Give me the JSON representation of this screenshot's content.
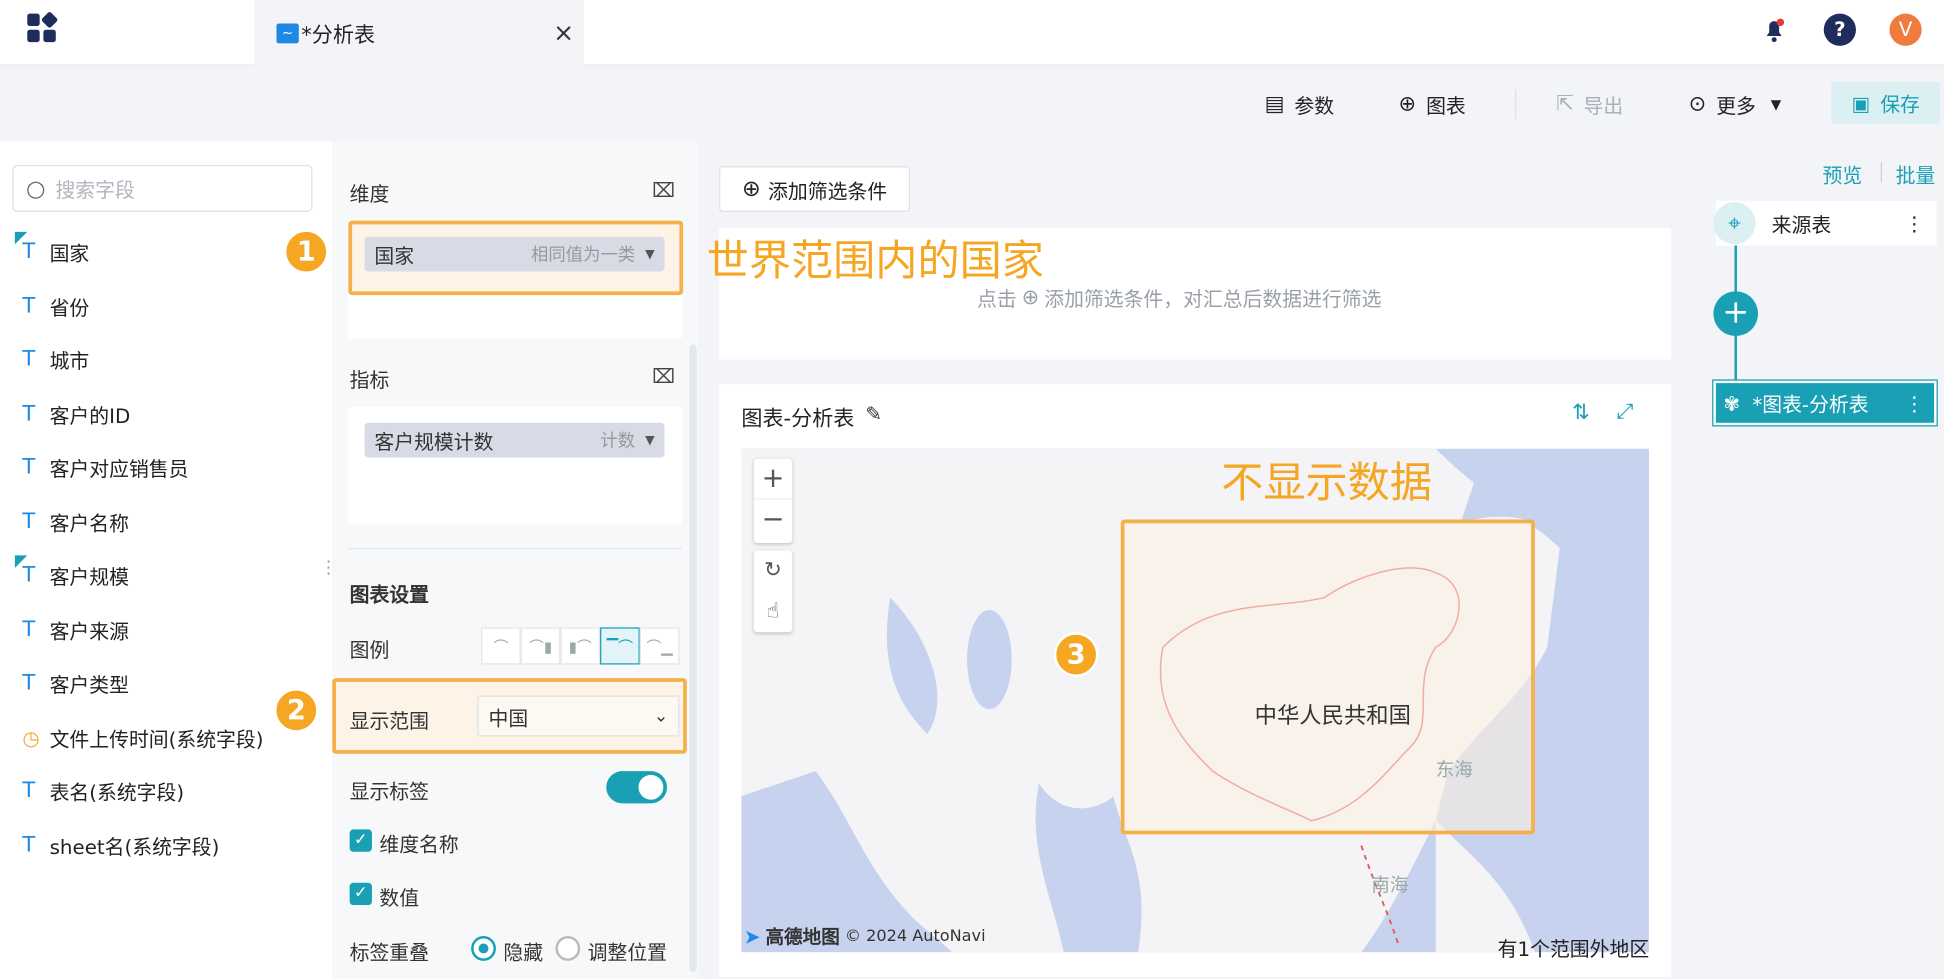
{
  "tab": {
    "title": "*分析表",
    "close": "×"
  },
  "topicons": {
    "user": "V"
  },
  "toolbar": {
    "params": "参数",
    "chart": "图表",
    "export": "导出",
    "more": "更多",
    "save": "保存"
  },
  "fields": {
    "search_placeholder": "搜索字段",
    "items": [
      "国家",
      "省份",
      "城市",
      "客户的ID",
      "客户对应销售员",
      "客户名称",
      "客户规模",
      "客户来源",
      "客户类型",
      "文件上传时间(系统字段)",
      "表名(系统字段)",
      "sheet名(系统字段)"
    ]
  },
  "config": {
    "dimension_label": "维度",
    "dimension_field": "国家",
    "dimension_agg": "相同值为一类",
    "metric_label": "指标",
    "metric_field": "客户规模计数",
    "metric_agg": "计数",
    "chart_settings": "图表设置",
    "legend": "图例",
    "range_label": "显示范围",
    "range_value": "中国",
    "show_label": "显示标签",
    "dim_name": "维度名称",
    "value": "数值",
    "overlap_label": "标签重叠",
    "hide": "隐藏",
    "adjust": "调整位置"
  },
  "annotations": {
    "n1": "1",
    "n2": "2",
    "n3": "3",
    "world": "世界范围内的国家",
    "nodata": "不显示数据"
  },
  "filter": {
    "add": "添加筛选条件",
    "hint_pre": "点击",
    "hint_post": "添加筛选条件，对汇总后数据进行筛选"
  },
  "chart": {
    "title": "图表-分析表",
    "country": "中华人民共和国",
    "east_sea": "东海",
    "south_sea": "南海",
    "attribution_brand": "高德地图",
    "attribution": "© 2024 AutoNavi",
    "outside": "有1个范围外地区"
  },
  "flow": {
    "preview": "预览",
    "batch": "批量",
    "source": "来源表",
    "chart_node": "*图表-分析表"
  },
  "colors": {
    "accent": "#1aa0b4",
    "annotation": "#f5a623"
  }
}
